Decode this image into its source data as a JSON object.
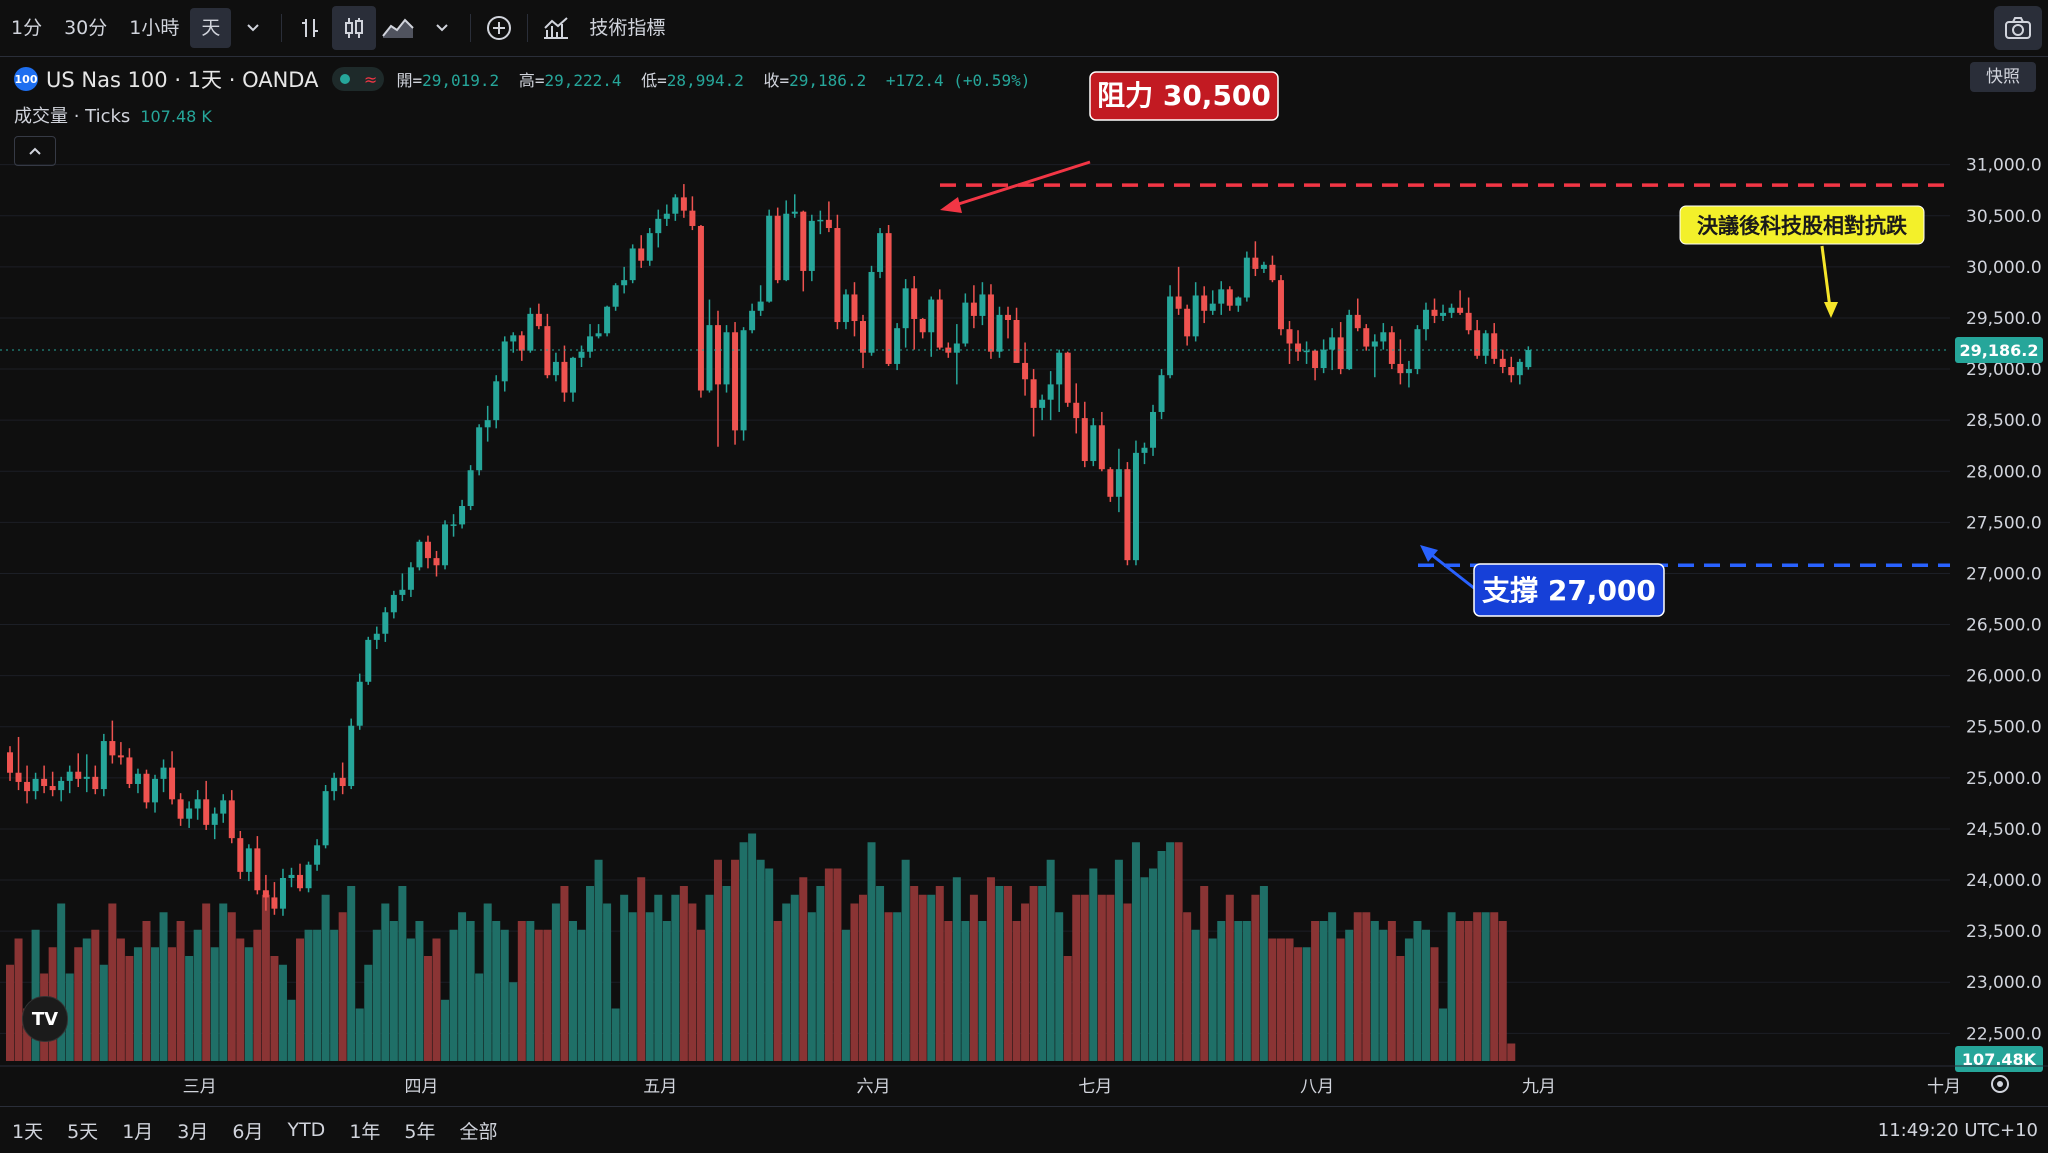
{
  "toolbar": {
    "intervals": [
      "1分",
      "30分",
      "1小時",
      "天"
    ],
    "active_interval": "天",
    "indicators_label": "技術指標",
    "snapshot_label": "快照"
  },
  "legend": {
    "badge": "100",
    "symbol": "US Nas 100 · 1天 · OANDA",
    "open_label": "開=",
    "open": "29,019.2",
    "high_label": "高=",
    "high": "29,222.4",
    "low_label": "低=",
    "low": "28,994.2",
    "close_label": "收=",
    "close": "29,186.2",
    "change": "+172.4 (+0.59%)",
    "volume_label": "成交量 · Ticks",
    "volume_value": "107.48 K"
  },
  "ranges": [
    "1天",
    "5天",
    "1月",
    "3月",
    "6月",
    "YTD",
    "1年",
    "5年",
    "全部"
  ],
  "clock": "11:49:20 UTC+10",
  "colors": {
    "up": "#26a69a",
    "down": "#ef5350",
    "up_vol": "#1f6f67",
    "down_vol": "#8a3434",
    "resistance": "#f23645",
    "support": "#2962ff",
    "note": "#f5e52a"
  },
  "chart_data": {
    "type": "candlestick",
    "title": "US Nas 100 · 1天 · OANDA",
    "x_tick_labels": [
      "三月",
      "四月",
      "五月",
      "六月",
      "七月",
      "八月",
      "九月",
      "十月"
    ],
    "y_tick_labels": [
      "31,000.0",
      "30,500.0",
      "30,000.0",
      "29,500.0",
      "29,000.0",
      "28,500.0",
      "28,000.0",
      "27,500.0",
      "27,000.0",
      "26,500.0",
      "26,000.0",
      "25,500.0",
      "25,000.0",
      "24,500.0",
      "24,000.0",
      "23,500.0",
      "23,000.0",
      "22,500.0"
    ],
    "ylim": [
      22200,
      31300
    ],
    "last_price_label": "29,186.2",
    "last_volume_label": "107.48K",
    "annotations": {
      "resistance": {
        "label": "阻力 30,500",
        "value": 30800
      },
      "support": {
        "label": "支撐 27,000",
        "value": 27080
      },
      "note": {
        "label": "決議後科技股相對抗跌"
      }
    },
    "candles": [
      [
        25250,
        25310,
        24970,
        25050
      ],
      [
        25050,
        25400,
        24880,
        24960
      ],
      [
        24960,
        25120,
        24750,
        24870
      ],
      [
        24870,
        25050,
        24790,
        24990
      ],
      [
        24990,
        25120,
        24850,
        24920
      ],
      [
        24920,
        25060,
        24820,
        24880
      ],
      [
        24880,
        25010,
        24770,
        24970
      ],
      [
        24970,
        25120,
        24850,
        25060
      ],
      [
        25060,
        25240,
        24910,
        24990
      ],
      [
        24990,
        25230,
        24860,
        25010
      ],
      [
        25010,
        25120,
        24840,
        24890
      ],
      [
        24890,
        25430,
        24820,
        25360
      ],
      [
        25360,
        25560,
        25140,
        25220
      ],
      [
        25220,
        25350,
        25130,
        25200
      ],
      [
        25200,
        25290,
        24900,
        24940
      ],
      [
        24940,
        25090,
        24850,
        25040
      ],
      [
        25040,
        25080,
        24700,
        24760
      ],
      [
        24760,
        25030,
        24660,
        24990
      ],
      [
        24990,
        25180,
        24860,
        25100
      ],
      [
        25100,
        25260,
        24740,
        24790
      ],
      [
        24790,
        24850,
        24530,
        24600
      ],
      [
        24600,
        24770,
        24510,
        24700
      ],
      [
        24700,
        24880,
        24590,
        24790
      ],
      [
        24790,
        24970,
        24490,
        24540
      ],
      [
        24540,
        24710,
        24400,
        24650
      ],
      [
        24650,
        24840,
        24560,
        24780
      ],
      [
        24780,
        24880,
        24360,
        24410
      ],
      [
        24410,
        24480,
        24010,
        24080
      ],
      [
        24080,
        24350,
        23990,
        24310
      ],
      [
        24310,
        24430,
        23860,
        23900
      ],
      [
        23900,
        24050,
        23700,
        23830
      ],
      [
        23830,
        23980,
        23660,
        23720
      ],
      [
        23720,
        24110,
        23650,
        24020
      ],
      [
        24020,
        24120,
        23930,
        24050
      ],
      [
        24050,
        24160,
        23890,
        23920
      ],
      [
        23920,
        24180,
        23880,
        24150
      ],
      [
        24150,
        24400,
        24090,
        24340
      ],
      [
        24340,
        24930,
        24310,
        24870
      ],
      [
        24870,
        25050,
        24780,
        25000
      ],
      [
        25000,
        25150,
        24840,
        24920
      ],
      [
        24920,
        25580,
        24890,
        25510
      ],
      [
        25510,
        26020,
        25470,
        25940
      ],
      [
        25940,
        26380,
        25910,
        26350
      ],
      [
        26350,
        26480,
        26260,
        26410
      ],
      [
        26410,
        26670,
        26330,
        26620
      ],
      [
        26620,
        26830,
        26560,
        26790
      ],
      [
        26790,
        27000,
        26730,
        26840
      ],
      [
        26840,
        27110,
        26770,
        27060
      ],
      [
        27060,
        27330,
        27030,
        27310
      ],
      [
        27310,
        27370,
        27050,
        27150
      ],
      [
        27150,
        27220,
        26970,
        27080
      ],
      [
        27080,
        27520,
        27040,
        27480
      ],
      [
        27480,
        27580,
        27360,
        27480
      ],
      [
        27480,
        27720,
        27440,
        27660
      ],
      [
        27660,
        28060,
        27620,
        28010
      ],
      [
        28010,
        28460,
        27960,
        28430
      ],
      [
        28430,
        28640,
        28290,
        28500
      ],
      [
        28500,
        28940,
        28420,
        28880
      ],
      [
        28880,
        29320,
        28780,
        29270
      ],
      [
        29270,
        29360,
        29160,
        29330
      ],
      [
        29330,
        29370,
        29080,
        29180
      ],
      [
        29180,
        29600,
        29160,
        29540
      ],
      [
        29540,
        29640,
        29390,
        29420
      ],
      [
        29420,
        29540,
        28910,
        28940
      ],
      [
        28940,
        29160,
        28880,
        29070
      ],
      [
        29070,
        29230,
        28680,
        28770
      ],
      [
        28770,
        29120,
        28680,
        29110
      ],
      [
        29110,
        29230,
        29020,
        29170
      ],
      [
        29170,
        29440,
        29110,
        29320
      ],
      [
        29320,
        29440,
        29300,
        29350
      ],
      [
        29350,
        29620,
        29320,
        29610
      ],
      [
        29610,
        29840,
        29570,
        29820
      ],
      [
        29820,
        30000,
        29740,
        29870
      ],
      [
        29870,
        30220,
        29840,
        30180
      ],
      [
        30180,
        30310,
        29990,
        30060
      ],
      [
        30060,
        30380,
        30010,
        30330
      ],
      [
        30330,
        30560,
        30190,
        30470
      ],
      [
        30470,
        30610,
        30400,
        30520
      ],
      [
        30520,
        30710,
        30450,
        30680
      ],
      [
        30680,
        30810,
        30480,
        30550
      ],
      [
        30550,
        30690,
        30360,
        30400
      ],
      [
        30400,
        30410,
        28720,
        28790
      ],
      [
        28790,
        29680,
        28770,
        29430
      ],
      [
        29430,
        29570,
        28240,
        28850
      ],
      [
        28850,
        29430,
        28770,
        29360
      ],
      [
        29360,
        29460,
        28260,
        28400
      ],
      [
        28400,
        29410,
        28300,
        29380
      ],
      [
        29380,
        29640,
        29350,
        29570
      ],
      [
        29570,
        29820,
        29520,
        29660
      ],
      [
        29660,
        30560,
        29650,
        30500
      ],
      [
        30500,
        30580,
        29840,
        29870
      ],
      [
        29870,
        30650,
        29860,
        30520
      ],
      [
        30520,
        30710,
        30480,
        30540
      ],
      [
        30540,
        30550,
        29760,
        29960
      ],
      [
        29960,
        30510,
        29860,
        30450
      ],
      [
        30450,
        30550,
        30320,
        30460
      ],
      [
        30460,
        30640,
        30340,
        30380
      ],
      [
        30380,
        30510,
        29390,
        29460
      ],
      [
        29460,
        29780,
        29390,
        29730
      ],
      [
        29730,
        29850,
        29320,
        29470
      ],
      [
        29470,
        29530,
        29010,
        29160
      ],
      [
        29160,
        30010,
        29130,
        29950
      ],
      [
        29950,
        30380,
        29890,
        30330
      ],
      [
        30330,
        30410,
        29030,
        29050
      ],
      [
        29050,
        29450,
        28990,
        29400
      ],
      [
        29400,
        29880,
        29210,
        29790
      ],
      [
        29790,
        29910,
        29190,
        29490
      ],
      [
        29490,
        29500,
        29300,
        29360
      ],
      [
        29360,
        29710,
        29120,
        29680
      ],
      [
        29680,
        29780,
        29190,
        29210
      ],
      [
        29210,
        29260,
        29110,
        29160
      ],
      [
        29160,
        29440,
        28850,
        29250
      ],
      [
        29250,
        29740,
        29220,
        29650
      ],
      [
        29650,
        29820,
        29400,
        29520
      ],
      [
        29520,
        29850,
        29430,
        29730
      ],
      [
        29730,
        29830,
        29100,
        29170
      ],
      [
        29170,
        29610,
        29110,
        29530
      ],
      [
        29530,
        29610,
        29300,
        29480
      ],
      [
        29480,
        29600,
        29060,
        29060
      ],
      [
        29060,
        29260,
        28740,
        28900
      ],
      [
        28900,
        29000,
        28340,
        28620
      ],
      [
        28620,
        28750,
        28500,
        28700
      ],
      [
        28700,
        28980,
        28500,
        28850
      ],
      [
        28850,
        29190,
        28580,
        29160
      ],
      [
        29160,
        29170,
        28630,
        28670
      ],
      [
        28670,
        28860,
        28370,
        28520
      ],
      [
        28520,
        28680,
        28040,
        28100
      ],
      [
        28100,
        28520,
        28050,
        28450
      ],
      [
        28450,
        28580,
        28000,
        28020
      ],
      [
        28020,
        28040,
        27700,
        27750
      ],
      [
        27750,
        28220,
        27600,
        28020
      ],
      [
        28020,
        28090,
        27080,
        27130
      ],
      [
        27130,
        28300,
        27080,
        28180
      ],
      [
        28180,
        28280,
        28070,
        28230
      ],
      [
        28230,
        28650,
        28150,
        28580
      ],
      [
        28580,
        29000,
        28510,
        28940
      ],
      [
        28940,
        29820,
        28910,
        29710
      ],
      [
        29710,
        30000,
        29530,
        29590
      ],
      [
        29590,
        29630,
        29230,
        29320
      ],
      [
        29320,
        29850,
        29270,
        29720
      ],
      [
        29720,
        29810,
        29450,
        29570
      ],
      [
        29570,
        29770,
        29530,
        29640
      ],
      [
        29640,
        29860,
        29530,
        29780
      ],
      [
        29780,
        29810,
        29570,
        29620
      ],
      [
        29620,
        29710,
        29560,
        29700
      ],
      [
        29700,
        30150,
        29660,
        30090
      ],
      [
        30090,
        30250,
        29910,
        29980
      ],
      [
        29980,
        30050,
        29940,
        30020
      ],
      [
        30020,
        30110,
        29850,
        29870
      ],
      [
        29870,
        29920,
        29330,
        29390
      ],
      [
        29390,
        29470,
        29050,
        29250
      ],
      [
        29250,
        29380,
        29080,
        29170
      ],
      [
        29170,
        29270,
        29050,
        29180
      ],
      [
        29180,
        29190,
        28890,
        29010
      ],
      [
        29010,
        29290,
        28960,
        29190
      ],
      [
        29190,
        29400,
        28990,
        29310
      ],
      [
        29310,
        29460,
        28950,
        29000
      ],
      [
        29000,
        29580,
        28990,
        29530
      ],
      [
        29530,
        29690,
        29370,
        29400
      ],
      [
        29400,
        29440,
        29180,
        29220
      ],
      [
        29220,
        29340,
        28920,
        29270
      ],
      [
        29270,
        29450,
        29190,
        29360
      ],
      [
        29360,
        29420,
        29000,
        29050
      ],
      [
        29050,
        29290,
        28850,
        28960
      ],
      [
        28960,
        29080,
        28820,
        29000
      ],
      [
        29000,
        29430,
        28950,
        29390
      ],
      [
        29390,
        29650,
        29280,
        29580
      ],
      [
        29580,
        29690,
        29450,
        29520
      ],
      [
        29520,
        29630,
        29470,
        29550
      ],
      [
        29550,
        29640,
        29500,
        29600
      ],
      [
        29600,
        29770,
        29530,
        29550
      ],
      [
        29550,
        29700,
        29340,
        29380
      ],
      [
        29380,
        29480,
        29100,
        29130
      ],
      [
        29130,
        29380,
        29050,
        29350
      ],
      [
        29350,
        29450,
        29050,
        29100
      ],
      [
        29100,
        29190,
        28960,
        29020
      ],
      [
        29020,
        29120,
        28870,
        28940
      ],
      [
        28940,
        29100,
        28850,
        29070
      ],
      [
        29019.2,
        29222.4,
        28994.2,
        29186.2
      ]
    ],
    "volumes": [
      23000,
      23300,
      22500,
      23400,
      22900,
      23200,
      23700,
      22900,
      23200,
      23300,
      23400,
      23000,
      23700,
      23300,
      23100,
      23200,
      23500,
      23200,
      23600,
      23200,
      23500,
      23100,
      23400,
      23700,
      23200,
      23700,
      23600,
      23300,
      23200,
      23400,
      23800,
      23100,
      23000,
      22600,
      23300,
      23400,
      23400,
      23800,
      23400,
      23600,
      23900,
      22500,
      23000,
      23400,
      23700,
      23500,
      23900,
      23300,
      23500,
      23100,
      23300,
      22600,
      23400,
      23600,
      23500,
      22900,
      23700,
      23500,
      23400,
      22800,
      23500,
      23500,
      23400,
      23400,
      23700,
      23900,
      23500,
      23400,
      23900,
      24200,
      23700,
      22500,
      23800,
      23600,
      24000,
      23600,
      23800,
      23500,
      23800,
      23900,
      23700,
      23400,
      23800,
      24200,
      23900,
      24200,
      24400,
      24500,
      24200,
      24100,
      23500,
      23700,
      23800,
      24000,
      23600,
      23900,
      24100,
      24100,
      23400,
      23700,
      23800,
      24400,
      23900,
      23600,
      23600,
      24200,
      23900,
      23800,
      23800,
      23900,
      23500,
      24000,
      23500,
      23800,
      23500,
      24000,
      23900,
      23900,
      23500,
      23700,
      23900,
      23900,
      24200,
      23600,
      23100,
      23800,
      23800,
      24100,
      23800,
      23800,
      24200,
      23700,
      24400,
      24000,
      24100,
      24300,
      24400,
      24400,
      23600,
      23400,
      23900,
      23300,
      23500,
      23800,
      23500,
      23500,
      23800,
      23900,
      23300,
      23300,
      23300,
      23200,
      23200,
      23500,
      23500,
      23600,
      23300,
      23400,
      23600,
      23600,
      23500,
      23400,
      23500,
      23100,
      23300,
      23500,
      23400,
      23200,
      22500,
      23600,
      23500,
      23500,
      23600,
      23600,
      23600,
      23500,
      22100
    ]
  }
}
